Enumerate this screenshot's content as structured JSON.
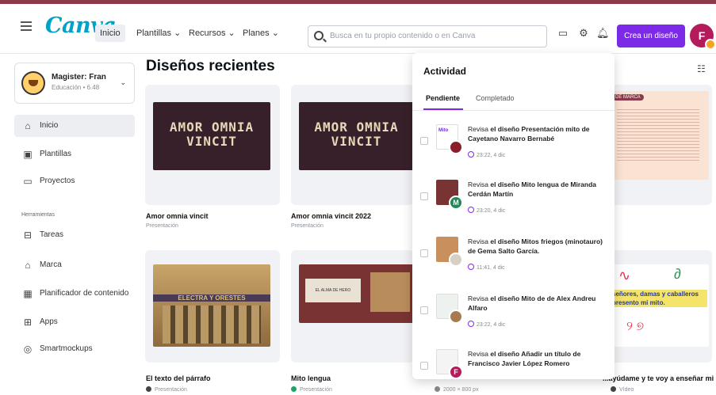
{
  "header": {
    "logo": "Canva",
    "nav": [
      "Inicio",
      "Plantillas",
      "Recursos",
      "Planes"
    ],
    "search_placeholder": "Busca en tu propio contenido o en Canva",
    "cta": "Crea un diseño",
    "avatar_initial": "F"
  },
  "sidebar": {
    "team_name": "Magister: Fran",
    "team_sub": "Educación • 6.48",
    "items": [
      "Inicio",
      "Plantillas",
      "Proyectos"
    ],
    "tools_header": "Herramientas",
    "tools": [
      "Tareas",
      "Marca",
      "Planificador de contenido",
      "Apps",
      "Smartmockups"
    ]
  },
  "main": {
    "title": "Diseños recientes",
    "cards": [
      {
        "thumb_text_1": "AMOR OMNIA",
        "thumb_text_2": "VINCIT",
        "title": "Amor omnia vincit",
        "sub": "Presentación"
      },
      {
        "thumb_text_1": "AMOR OMNIA",
        "thumb_text_2": "VINCIT",
        "title": "Amor omnia vincit 2022",
        "sub": "Presentación"
      },
      {
        "title": "El texto del párrafo",
        "sub": "Presentación",
        "thumb_text": "ELECTRA Y ORESTES"
      },
      {
        "title": "Mito lengua",
        "sub": "Presentación",
        "thumb_text": "EL ALMA DE HERO"
      },
      {
        "title": "",
        "sub": "2000 × 800 px"
      },
      {
        "title": "...ayúdame y te voy a enseñar mi ...",
        "sub": "Vídeo",
        "thumb_text": "señores, damas y caballeros presento mi mito."
      }
    ],
    "brand_thumb_label": "DE MARCA"
  },
  "activity": {
    "title": "Actividad",
    "tabs": [
      "Pendiente",
      "Completado"
    ],
    "items": [
      {
        "prefix": "Revisa ",
        "bold": "el diseño Presentación mito de Cayetano Navarro Bernabé",
        "time": "23:22, 4 dic"
      },
      {
        "prefix": "Revisa ",
        "bold": "el diseño Mito lengua de Miranda Cerdán Martín",
        "time": "23:20, 4 dic"
      },
      {
        "prefix": "Revisa ",
        "bold": "el diseño Mitos friegos (minotauro) de Gema Salto García.",
        "time": "11:41, 4 dic"
      },
      {
        "prefix": "Revisa ",
        "bold": "el diseño Mito de de Alex Andreu Alfaro",
        "time": "23:22, 4 dic"
      },
      {
        "prefix": "Revisa ",
        "bold": "el diseño Añadir un título de Francisco Javier López Romero",
        "time": ""
      }
    ],
    "avatar_letters": [
      "",
      "M",
      "",
      "",
      "F"
    ]
  },
  "colors": {
    "accent": "#7d2ae8",
    "logo": "#00a3c8",
    "amor_bg": "#38202a"
  }
}
